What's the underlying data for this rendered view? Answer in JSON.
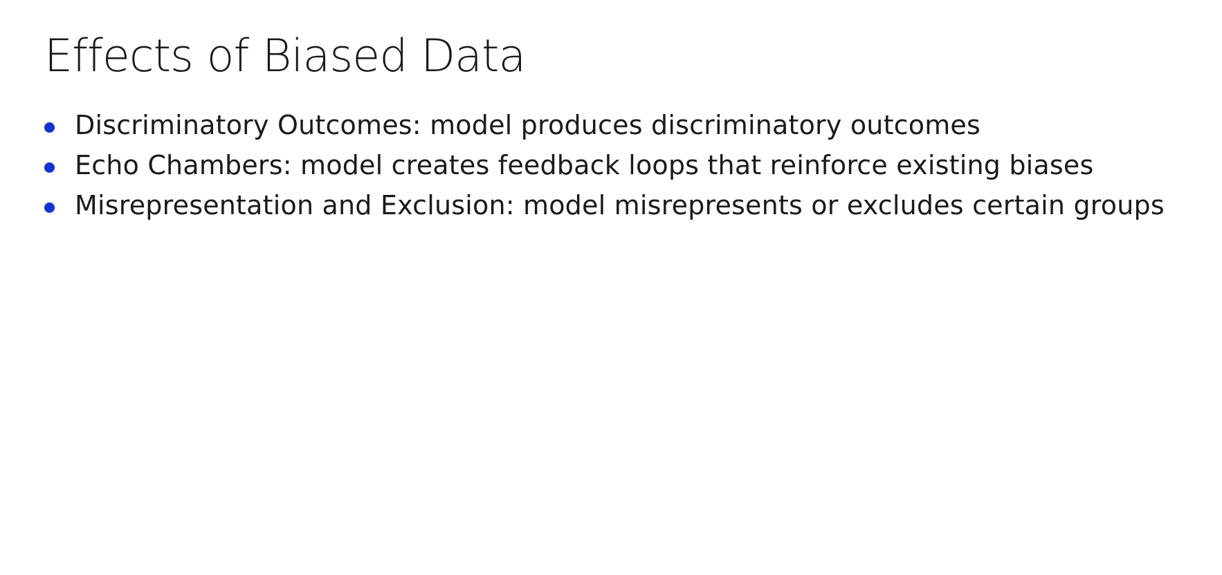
{
  "slide": {
    "title": "Effects of Biased Data",
    "bullet_color": "#1431d8",
    "bullets": [
      {
        "text": "Discriminatory Outcomes: model produces discriminatory outcomes"
      },
      {
        "text": "Echo Chambers: model creates feedback loops that reinforce existing biases"
      },
      {
        "text": "Misrepresentation and Exclusion: model misrepresents or excludes certain groups"
      }
    ]
  }
}
